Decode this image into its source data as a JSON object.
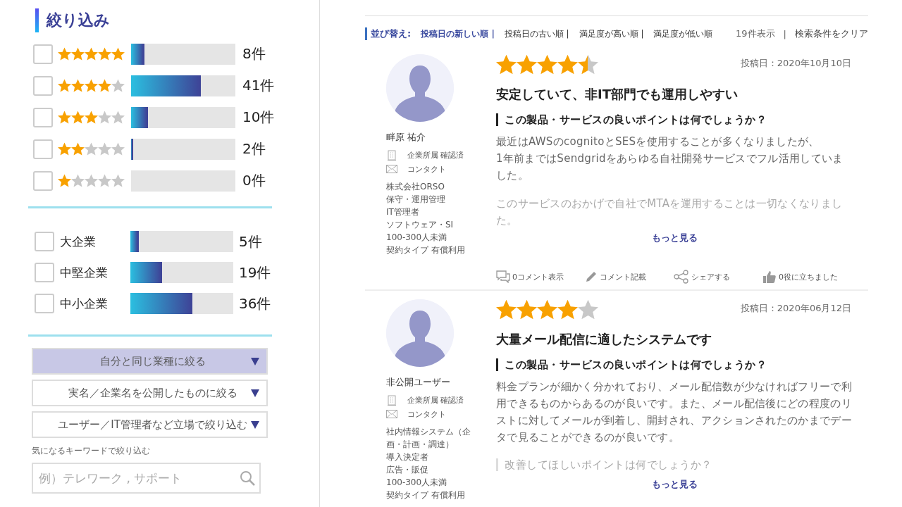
{
  "filter": {
    "title": "絞り込み",
    "rating_filters": [
      {
        "stars": 5,
        "checked": false,
        "level": 0.13,
        "count": "8件"
      },
      {
        "stars": 4,
        "checked": false,
        "level": 0.67,
        "count": "41件"
      },
      {
        "stars": 3,
        "checked": false,
        "level": 0.16,
        "count": "10件"
      },
      {
        "stars": 2,
        "checked": false,
        "level": 0.02,
        "count": "2件"
      },
      {
        "stars": 1,
        "checked": false,
        "level": 0,
        "count": "0件"
      }
    ],
    "company_filters": [
      {
        "label": "大企業",
        "checked": false,
        "level": 0.08,
        "count": "5件"
      },
      {
        "label": "中堅企業",
        "checked": false,
        "level": 0.31,
        "count": "19件"
      },
      {
        "label": "中小企業",
        "checked": false,
        "level": 0.6,
        "count": "36件"
      }
    ],
    "dropdowns": [
      {
        "label": "自分と同じ業種に絞る",
        "selected": true
      },
      {
        "label": "実名／企業名を公開したものに絞る",
        "selected": false
      },
      {
        "label": "ユーザー／IT管理者など立場で絞り込む",
        "selected": false
      }
    ],
    "keyword": {
      "label": "気になるキーワードで絞り込む",
      "placeholder": "例）テレワーク , サポート"
    }
  },
  "sort_bar": {
    "label": "並び替え:",
    "options": [
      {
        "label": "投稿日の新しい順 |",
        "selected": true
      },
      {
        "label": "投稿日の古い順 |",
        "selected": false
      },
      {
        "label": "満足度が高い順 |",
        "selected": false
      },
      {
        "label": "満足度が低い順",
        "selected": false
      }
    ],
    "result_count": "19件表示",
    "separator": "|",
    "clear_link": "検索条件をクリア"
  },
  "reviews": [
    {
      "stars": 4.5,
      "date": "投稿日：2020年10月10日",
      "title": "安定していて、非IT部門でも運用しやすい",
      "reviewer": {
        "name": "畔原 祐介",
        "verified": "企業所属 確認済",
        "contact": "コンタクト",
        "profile": [
          "株式会社ORSO",
          "保守・運用管理",
          "IT管理者",
          "ソフトウェア・SI",
          "100-300人未満",
          "契約タイプ 有償利用"
        ]
      },
      "body": [
        {
          "kind": "heading",
          "text": "この製品・サービスの良いポイントは何でしょうか？"
        },
        {
          "kind": "text",
          "text": "最近はAWSのcognitoとSESを使用することが多くなりましたが、"
        },
        {
          "kind": "text",
          "text": "1年前まではSendgridをあらゆる自社開発サービスでフル活用していました。"
        },
        {
          "kind": "faded_text",
          "text": "このサービスのおかげで自社でMTAを運用することは一切なくなりました。"
        }
      ],
      "more_link": "もっと見る",
      "actions": [
        {
          "kind": "comments",
          "label": "0コメント表示"
        },
        {
          "kind": "write",
          "label": "コメント記載"
        },
        {
          "kind": "share",
          "label": "シェアする"
        },
        {
          "kind": "helpful",
          "label": "0役に立ちました"
        }
      ]
    },
    {
      "stars": 4,
      "date": "投稿日：2020年06月12日",
      "title": "大量メール配信に適したシステムです",
      "reviewer": {
        "name": "非公開ユーザー",
        "verified": "企業所属 確認済",
        "contact": "コンタクト",
        "profile": [
          "社内情報システム（企画・計画・調達）",
          "導入決定者",
          "広告・販促",
          "100-300人未満",
          "契約タイプ 有償利用"
        ]
      },
      "body": [
        {
          "kind": "heading",
          "text": "この製品・サービスの良いポイントは何でしょうか？"
        },
        {
          "kind": "text",
          "text": "料金プランが細かく分かれており、メール配信数が少なければフリーで利用できるものからあるのが良いです。また、メール配信後にどの程度のリストに対してメールが到着し、開封され、アクションされたのかまでデータで見ることができるのが良いです。"
        },
        {
          "kind": "faded_heading",
          "text": "改善してほしいポイントは何でしょうか？"
        }
      ],
      "more_link": "もっと見る"
    }
  ]
}
